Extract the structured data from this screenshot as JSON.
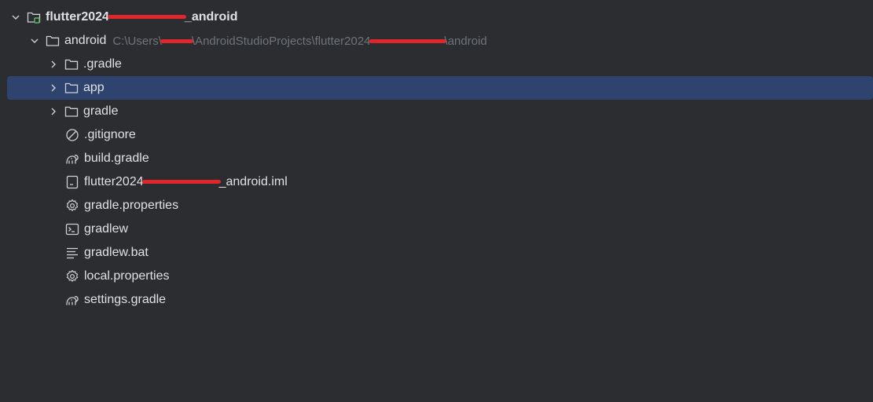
{
  "tree": {
    "root": {
      "name_prefix": "flutter2024",
      "name_suffix": "_android"
    },
    "android": {
      "name": "android",
      "path_prefix": "C:\\Users\\",
      "path_middle": "\\AndroidStudioProjects\\flutter2024",
      "path_suffix": "\\android"
    },
    "items": [
      {
        "label": ".gradle",
        "icon": "folder-icon",
        "expandable": true,
        "selected": false
      },
      {
        "label": "app",
        "icon": "folder-icon",
        "expandable": true,
        "selected": true
      },
      {
        "label": "gradle",
        "icon": "folder-icon",
        "expandable": true,
        "selected": false
      },
      {
        "label": ".gitignore",
        "icon": "ignore-file-icon",
        "expandable": false,
        "selected": false
      },
      {
        "label": "build.gradle",
        "icon": "gradle-elephant-icon",
        "expandable": false,
        "selected": false
      },
      {
        "label_prefix": "flutter2024",
        "label_suffix": "_android.iml",
        "icon": "module-file-icon",
        "expandable": false,
        "selected": false
      },
      {
        "label": "gradle.properties",
        "icon": "settings-gear-icon",
        "expandable": false,
        "selected": false
      },
      {
        "label": "gradlew",
        "icon": "terminal-icon",
        "expandable": false,
        "selected": false
      },
      {
        "label": "gradlew.bat",
        "icon": "text-file-icon",
        "expandable": false,
        "selected": false
      },
      {
        "label": "local.properties",
        "icon": "settings-gear-icon",
        "expandable": false,
        "selected": false
      },
      {
        "label": "settings.gradle",
        "icon": "gradle-elephant-icon",
        "expandable": false,
        "selected": false
      }
    ]
  },
  "colors": {
    "background": "#2b2d30",
    "selection": "#2e436e",
    "text": "#dfe1e5",
    "path_text": "#6f737a",
    "redaction": "#e0262b",
    "module_badge": "#5fb865"
  }
}
